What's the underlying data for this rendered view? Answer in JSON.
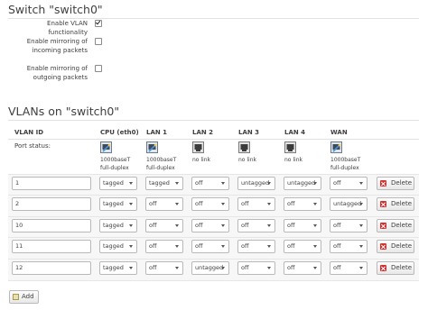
{
  "switch_title": "Switch \"switch0\"",
  "settings": [
    {
      "label_lines": [
        "Enable VLAN functionality"
      ],
      "checked": true
    },
    {
      "label_lines": [
        "Enable mirroring of",
        "incoming packets"
      ],
      "checked": false
    },
    {
      "label_lines": [
        "Enable mirroring of",
        "outgoing packets"
      ],
      "checked": false
    }
  ],
  "vlans_title": "VLANs on \"switch0\"",
  "columns": [
    "VLAN ID",
    "CPU (eth0)",
    "LAN 1",
    "LAN 2",
    "LAN 3",
    "LAN 4",
    "WAN"
  ],
  "port_status_label": "Port status:",
  "port_status": [
    {
      "icon": "port-up-icon",
      "lines": [
        "1000baseT",
        "full-duplex"
      ]
    },
    {
      "icon": "port-up-icon",
      "lines": [
        "1000baseT",
        "full-duplex"
      ]
    },
    {
      "icon": "port-down-icon",
      "lines": [
        "no link"
      ]
    },
    {
      "icon": "port-down-icon",
      "lines": [
        "no link"
      ]
    },
    {
      "icon": "port-down-icon",
      "lines": [
        "no link"
      ]
    },
    {
      "icon": "port-up-icon",
      "lines": [
        "1000baseT",
        "full-duplex"
      ]
    }
  ],
  "vlans": [
    {
      "id": "1",
      "ports": [
        "tagged",
        "tagged",
        "off",
        "untagged",
        "untagged",
        "off"
      ]
    },
    {
      "id": "2",
      "ports": [
        "tagged",
        "off",
        "off",
        "off",
        "off",
        "untagged"
      ]
    },
    {
      "id": "10",
      "ports": [
        "tagged",
        "off",
        "off",
        "off",
        "off",
        "off"
      ]
    },
    {
      "id": "11",
      "ports": [
        "tagged",
        "off",
        "off",
        "off",
        "off",
        "off"
      ]
    },
    {
      "id": "12",
      "ports": [
        "tagged",
        "off",
        "untagged",
        "off",
        "off",
        "off"
      ]
    }
  ],
  "delete_label": "Delete",
  "add_label": "Add"
}
